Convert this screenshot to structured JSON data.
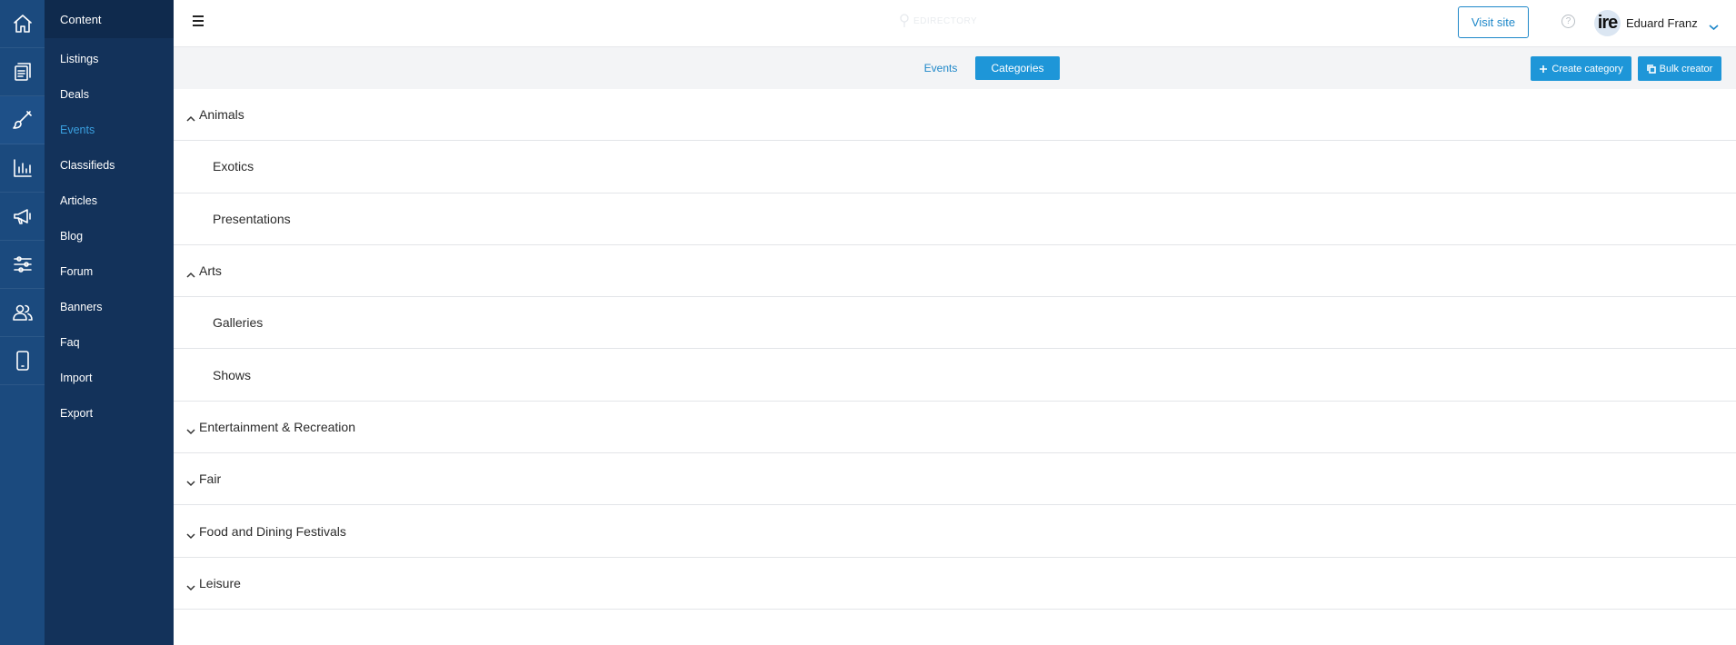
{
  "rail": {
    "items": [
      {
        "icon": "home-icon"
      },
      {
        "icon": "content-pages-icon"
      },
      {
        "icon": "brush-icon",
        "active": true
      },
      {
        "icon": "bar-chart-icon"
      },
      {
        "icon": "megaphone-icon"
      },
      {
        "icon": "sliders-icon"
      },
      {
        "icon": "users-icon"
      },
      {
        "icon": "mobile-icon"
      }
    ]
  },
  "sidebar": {
    "title": "Content",
    "items": [
      {
        "label": "Listings"
      },
      {
        "label": "Deals"
      },
      {
        "label": "Events",
        "active": true
      },
      {
        "label": "Classifieds"
      },
      {
        "label": "Articles"
      },
      {
        "label": "Blog"
      },
      {
        "label": "Forum"
      },
      {
        "label": "Banners"
      },
      {
        "label": "Faq"
      },
      {
        "label": "Import"
      },
      {
        "label": "Export"
      }
    ]
  },
  "header": {
    "logo_text": "EDIRECTORY",
    "visit_site": "Visit site",
    "help": "?",
    "user": {
      "avatar_text": "ire",
      "name": "Eduard Franz"
    }
  },
  "toolbar": {
    "tab_events": "Events",
    "tab_categories": "Categories",
    "create_category": "Create category",
    "bulk_creator": "Bulk creator"
  },
  "categories": [
    {
      "label": "Animals",
      "level": 0,
      "expanded": true
    },
    {
      "label": "Exotics",
      "level": 1
    },
    {
      "label": "Presentations",
      "level": 1
    },
    {
      "label": "Arts",
      "level": 0,
      "expanded": true
    },
    {
      "label": "Galleries",
      "level": 1
    },
    {
      "label": "Shows",
      "level": 1
    },
    {
      "label": "Entertainment & Recreation",
      "level": 0,
      "expanded": false
    },
    {
      "label": "Fair",
      "level": 0,
      "expanded": false
    },
    {
      "label": "Food and Dining Festivals",
      "level": 0,
      "expanded": false
    },
    {
      "label": "Leisure",
      "level": 0,
      "expanded": false
    }
  ],
  "colors": {
    "rail_bg": "#1b4a7e",
    "sidebar_bg": "#13325a",
    "accent": "#1e96d8",
    "active_link": "#3aa0e0"
  }
}
